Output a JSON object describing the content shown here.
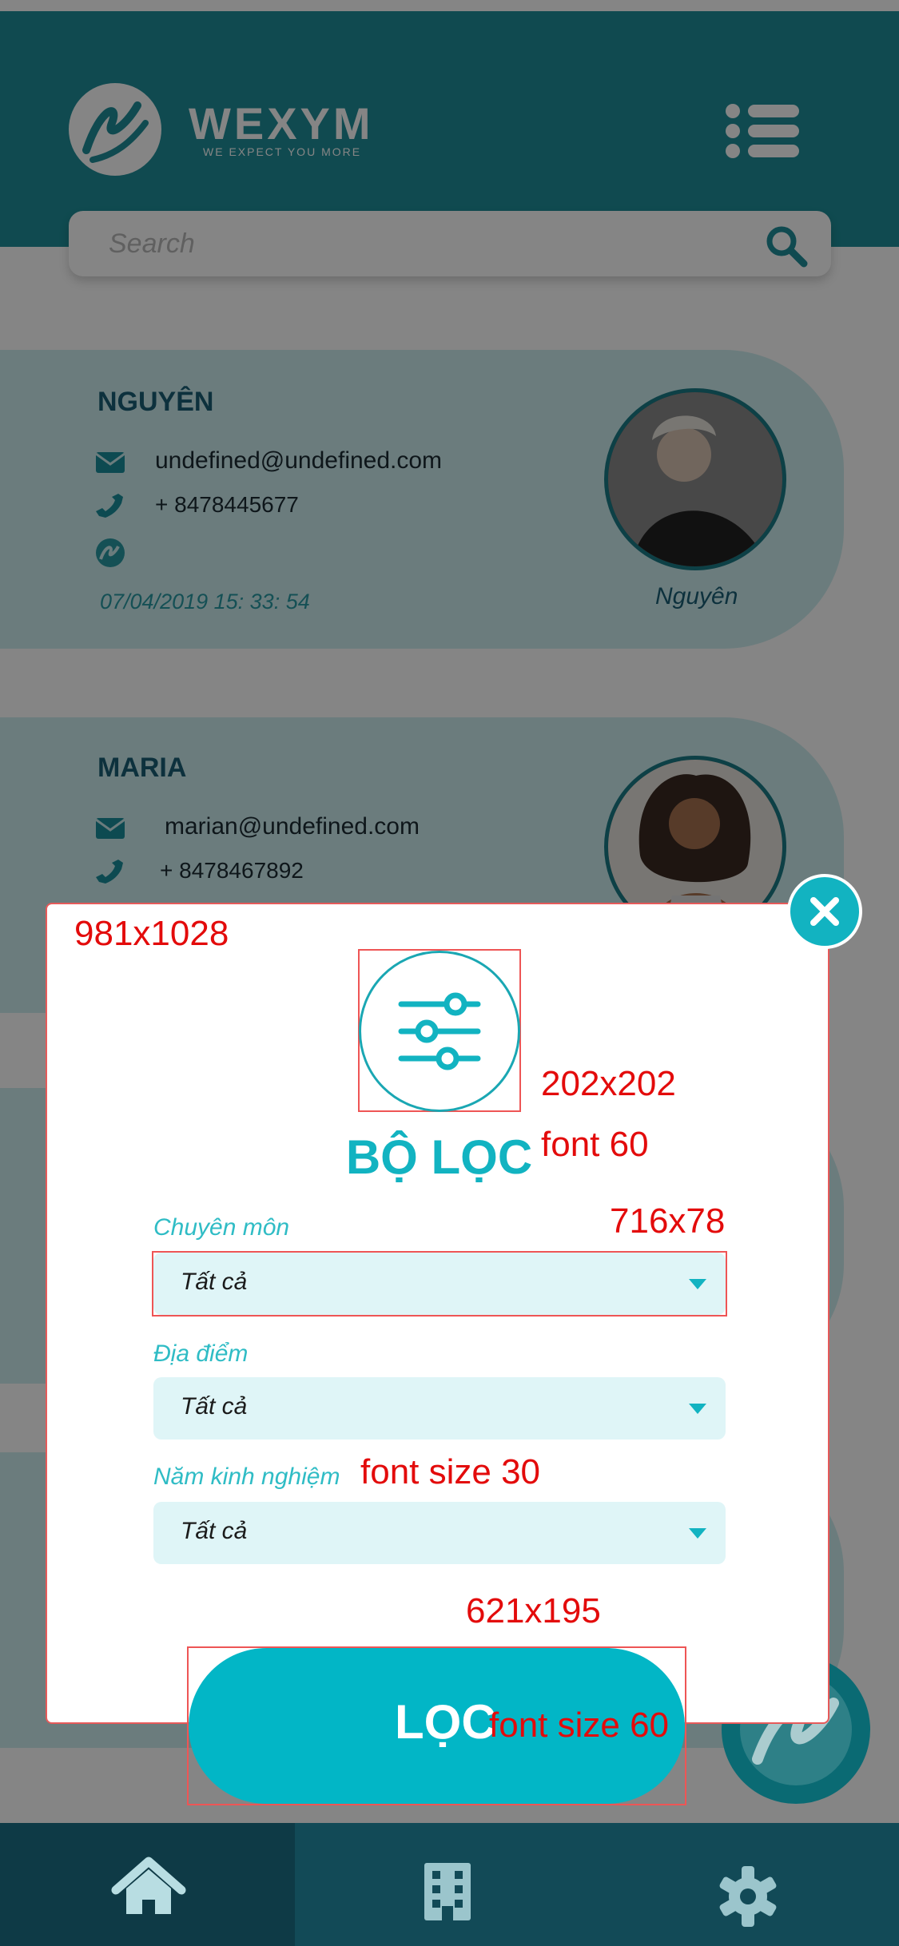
{
  "header": {
    "brand_name": "WEXYM",
    "tagline": "WE EXPECT YOU MORE"
  },
  "search": {
    "placeholder": "Search"
  },
  "cards": [
    {
      "name": "NGUYÊN",
      "email": "undefined@undefined.com",
      "phone": "+ 8478445677",
      "date": "07/04/2019 15: 33: 54",
      "avatar_caption": "Nguyên"
    },
    {
      "name": "MARIA",
      "email": "marian@undefined.com",
      "phone": "+ 8478467892"
    }
  ],
  "modal": {
    "title": "BỘ LỌC",
    "fields": [
      {
        "label": "Chuyên môn",
        "value": "Tất cả"
      },
      {
        "label": "Địa điểm",
        "value": "Tất cả"
      },
      {
        "label": "Năm kinh nghiệm",
        "value": "Tất cả"
      }
    ],
    "apply_label": "LỌC"
  },
  "annotations": {
    "modal_size": "981x1028",
    "icon_size": "202x202",
    "title_font": "font 60",
    "select_size": "716x78",
    "label_font": "font size 30",
    "button_size": "621x195",
    "button_font": "font size 60"
  },
  "colors": {
    "brand_teal": "#1f8f99",
    "accent_cyan": "#02b6c6",
    "nav_dark": "#124a57",
    "select_bg": "#dff5f7",
    "annotation_red": "#e30b0b"
  },
  "icons": {
    "menu": "hamburger-menu-icon",
    "search": "search-icon",
    "email": "envelope-icon",
    "phone": "phone-icon",
    "brand": "wexym-logo-icon",
    "filter": "sliders-icon",
    "close": "close-icon",
    "home": "home-icon",
    "company": "building-icon",
    "settings": "gear-icon"
  }
}
